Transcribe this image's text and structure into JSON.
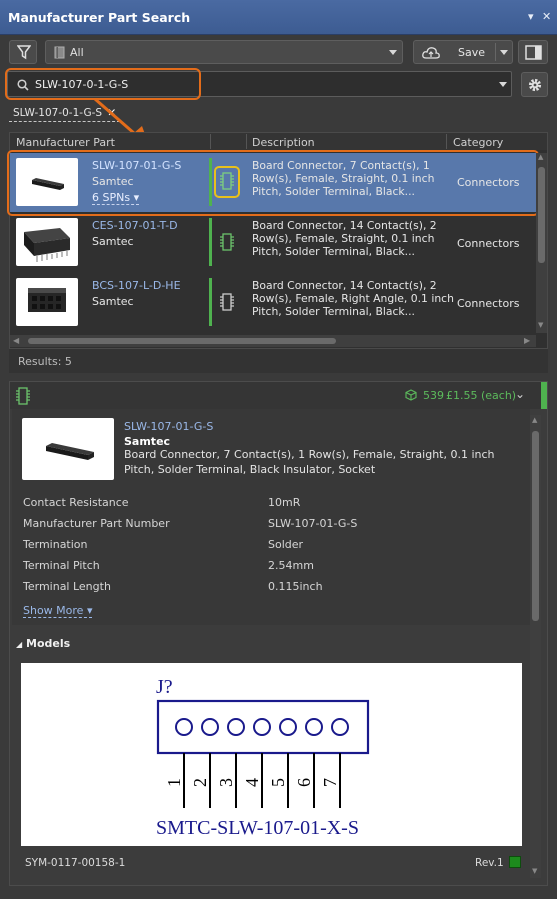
{
  "panel": {
    "title": "Manufacturer Part Search",
    "controls": [
      "▾",
      "✕"
    ]
  },
  "toolbar": {
    "scope_value": "All",
    "save_label": "Save"
  },
  "search": {
    "value": "SLW-107-0-1-G-S",
    "chip": "SLW-107-0-1-G-S"
  },
  "table": {
    "headers": [
      "Manufacturer Part",
      "Description",
      "Category"
    ],
    "rows": [
      {
        "part": "SLW-107-01-G-S",
        "manufacturer": "Samtec",
        "spns": "6 SPNs",
        "description": [
          "Board Connector, 7 Contact(s), 1",
          "Row(s), Female, Straight, 0.1 inch",
          "Pitch, Solder Terminal, Black..."
        ],
        "category": "Connectors"
      },
      {
        "part": "CES-107-01-T-D",
        "manufacturer": "Samtec",
        "spns": "",
        "description": [
          "Board Connector, 14 Contact(s), 2",
          "Row(s), Female, Straight, 0.1 inch",
          "Pitch, Solder Terminal, Black..."
        ],
        "category": "Connectors"
      },
      {
        "part": "BCS-107-L-D-HE",
        "manufacturer": "Samtec",
        "spns": "",
        "description": [
          "Board Connector, 14 Contact(s), 2",
          "Row(s), Female, Right Angle, 0.1 inch",
          "Pitch, Solder Terminal, Black..."
        ],
        "category": "Connectors"
      }
    ],
    "results_count": "Results: 5"
  },
  "detail": {
    "stock": "539",
    "price": "£1.55 (each)",
    "part": "SLW-107-01-G-S",
    "manufacturer": "Samtec",
    "description": "Board Connector, 7 Contact(s), 1 Row(s), Female, Straight, 0.1 inch Pitch, Solder Terminal, Black Insulator, Socket",
    "properties": [
      {
        "label": "Contact Resistance",
        "value": "10mR"
      },
      {
        "label": "Manufacturer Part Number",
        "value": "SLW-107-01-G-S"
      },
      {
        "label": "Termination",
        "value": "Solder"
      },
      {
        "label": "Terminal Pitch",
        "value": "2.54mm"
      },
      {
        "label": "Terminal Length",
        "value": "0.115inch"
      }
    ],
    "show_more": "Show More",
    "models_label": "Models",
    "symbol": {
      "designator": "J?",
      "pins": [
        "1",
        "2",
        "3",
        "4",
        "5",
        "6",
        "7"
      ],
      "name": "SMTC-SLW-107-01-X-S"
    },
    "symbol_id": "SYM-0117-00158-1",
    "revision": "Rev.1"
  },
  "colors": {
    "accent_orange": "#e36c1a",
    "selected_row": "#5878ab",
    "link_blue": "#9ab8e8",
    "status_green": "#4fb24f",
    "chip_yellow": "#e8c11c"
  }
}
